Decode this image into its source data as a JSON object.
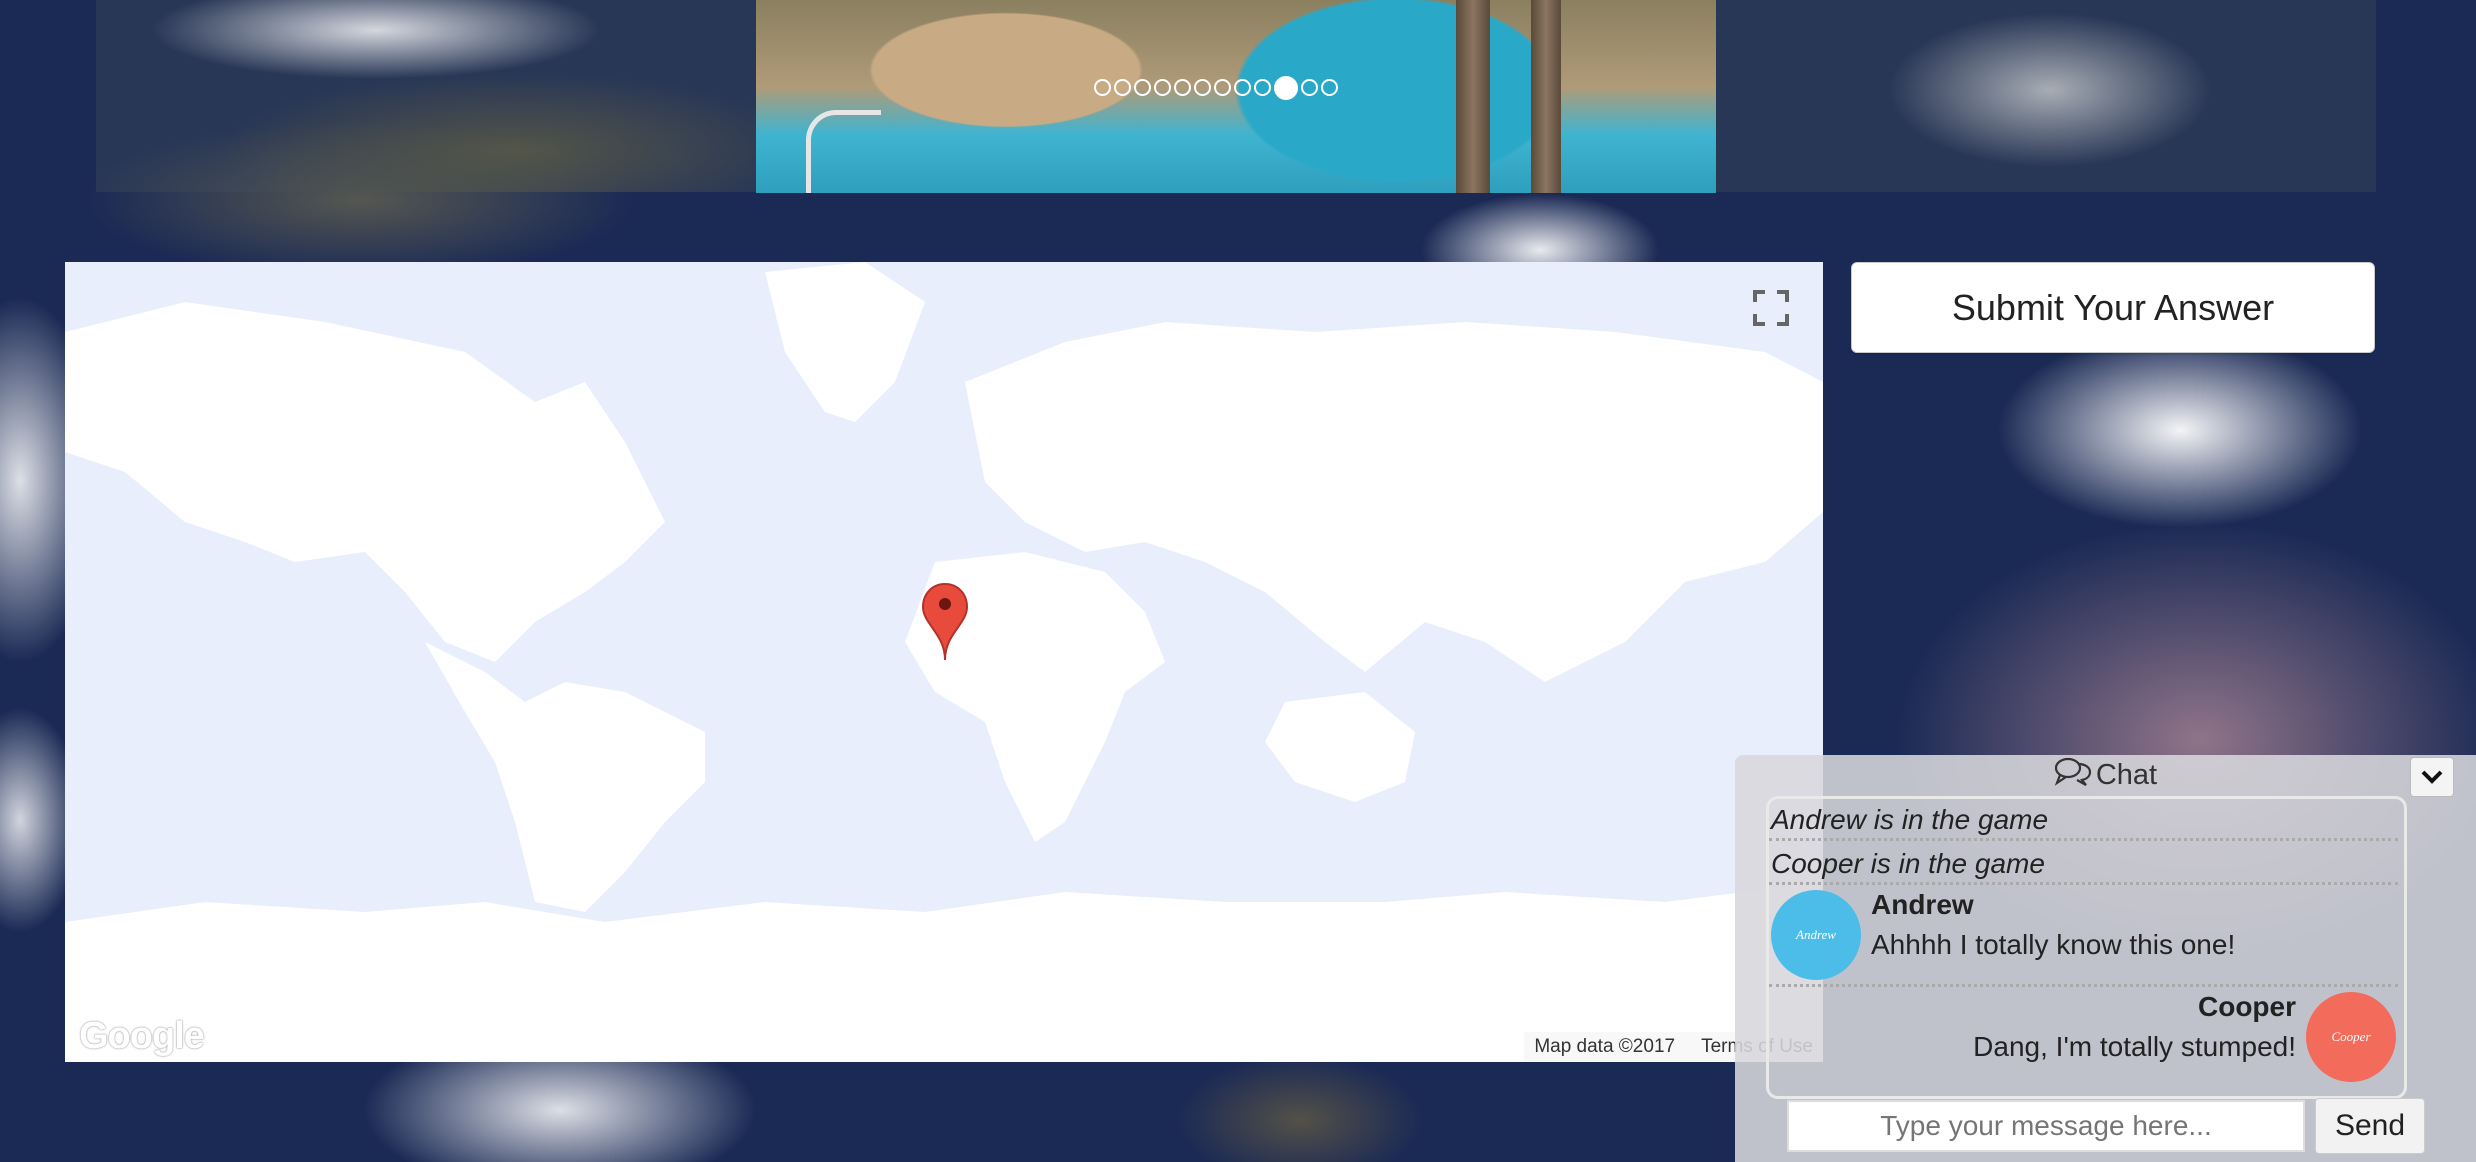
{
  "carousel": {
    "slide_count": 12,
    "active_index": 9
  },
  "map": {
    "attribution": "Map data ©2017",
    "terms_label": "Terms of Use",
    "logo_text": "Google",
    "fullscreen_icon": "fullscreen-icon",
    "marker_icon": "map-pin-icon",
    "background_color": "#e8eefc"
  },
  "submit": {
    "label": "Submit Your Answer"
  },
  "chat": {
    "title": "Chat",
    "title_icon": "chat-bubbles-icon",
    "collapse_icon": "chevron-down-icon",
    "system_messages": [
      "Andrew is in the game",
      "Cooper is in the game"
    ],
    "messages": [
      {
        "name": "Andrew",
        "avatar_label": "Andrew",
        "text": "Ahhhh I totally know this one!",
        "side": "left",
        "avatar_color": "#4bbde8"
      },
      {
        "name": "Cooper",
        "avatar_label": "Cooper",
        "text": "Dang, I'm totally stumped!",
        "side": "right",
        "avatar_color": "#f26b5b"
      }
    ],
    "input_placeholder": "Type your message here...",
    "input_value": "",
    "send_label": "Send"
  }
}
